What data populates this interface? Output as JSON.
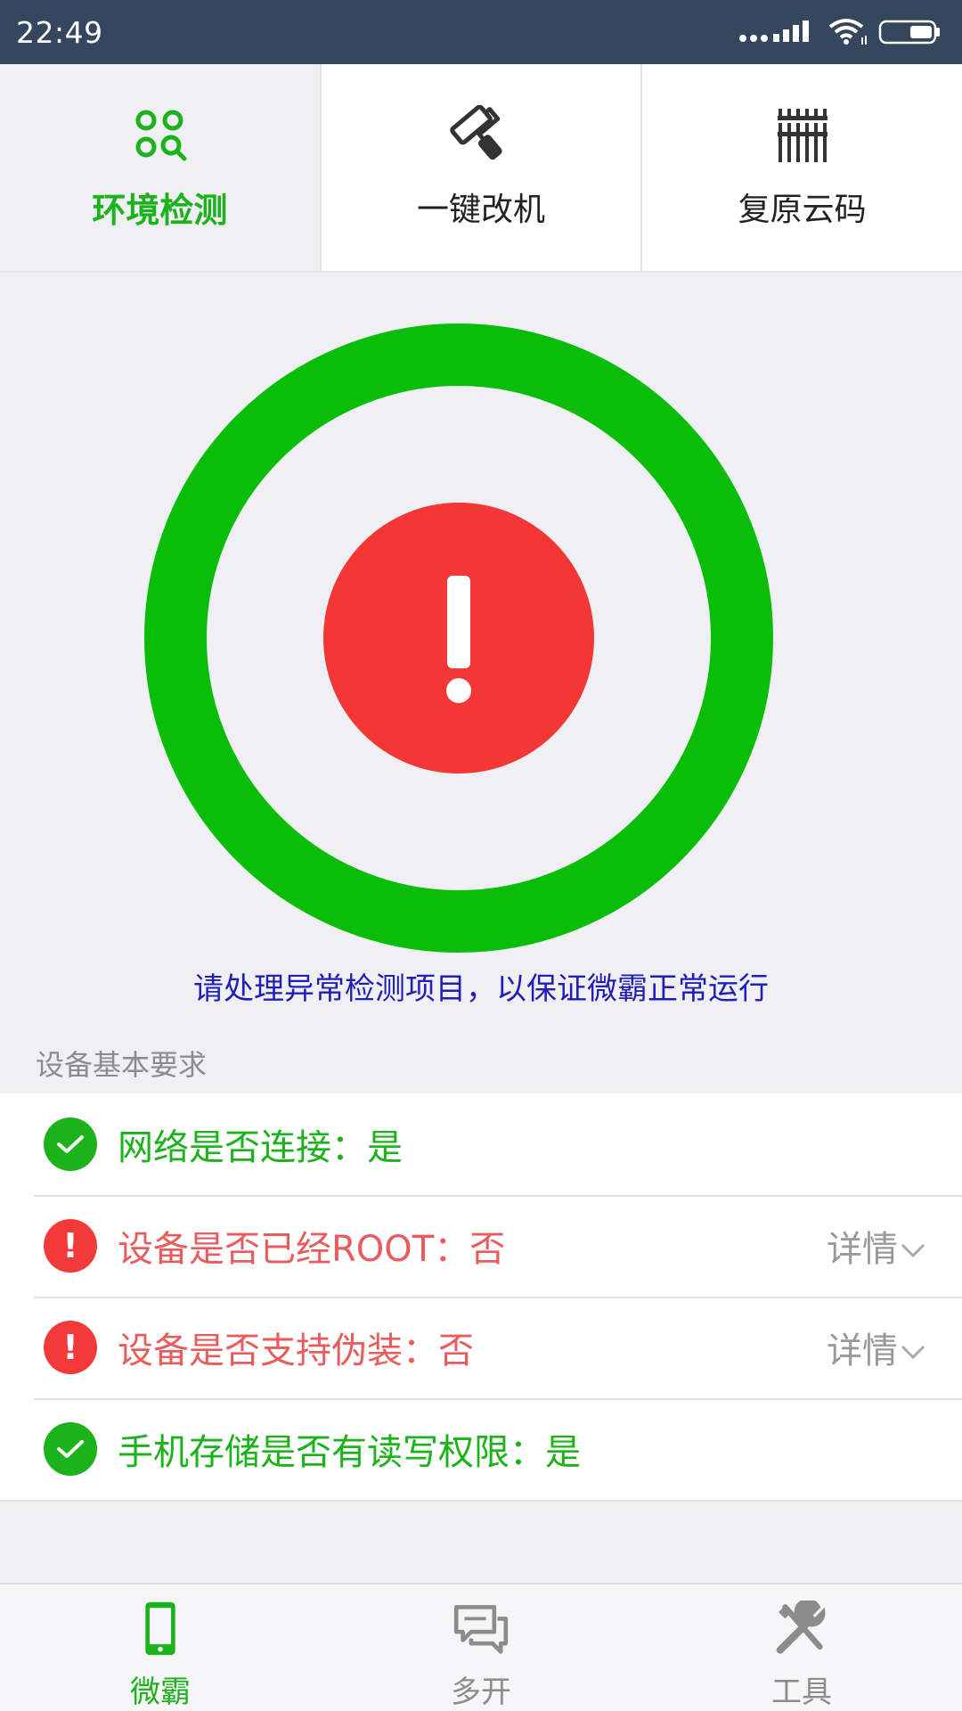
{
  "status_bar": {
    "time": "22:49"
  },
  "top_tabs": [
    {
      "label": "环境检测",
      "icon": "grid-search-icon",
      "active": true
    },
    {
      "label": "一键改机",
      "icon": "paint-roller-icon",
      "active": false
    },
    {
      "label": "复原云码",
      "icon": "barcode-icon",
      "active": false
    }
  ],
  "gauge": {
    "ring_color": "#09bd09",
    "alert_color": "#f43735",
    "alert_symbol": "!"
  },
  "hint_text": "请处理异常检测项目，以保证微霸正常运行",
  "section_title": "设备基本要求",
  "checks": [
    {
      "text": "网络是否连接：是",
      "status": "ok"
    },
    {
      "text": "设备是否已经ROOT：否",
      "status": "error",
      "detail": "详情"
    },
    {
      "text": "设备是否支持伪装：否",
      "status": "error",
      "detail": "详情"
    },
    {
      "text": "手机存储是否有读写权限：是",
      "status": "ok"
    }
  ],
  "bottom_nav": [
    {
      "label": "微霸",
      "icon": "phone-icon",
      "active": true
    },
    {
      "label": "多开",
      "icon": "chat-bubbles-icon",
      "active": false
    },
    {
      "label": "工具",
      "icon": "tools-icon",
      "active": false
    }
  ],
  "colors": {
    "accent": "#1bb21b",
    "error": "#f23a3a",
    "status_bar": "#35475d",
    "hint": "#1f1fb5"
  }
}
